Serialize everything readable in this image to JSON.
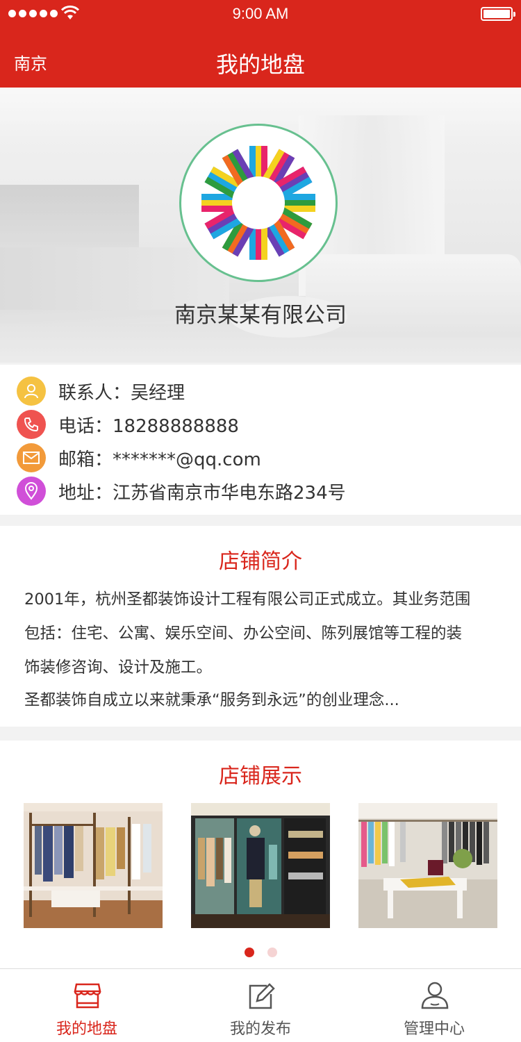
{
  "status_bar": {
    "time": "9:00 AM"
  },
  "nav": {
    "city": "南京",
    "title": "我的地盘"
  },
  "hero": {
    "company_name": "南京某某有限公司",
    "logo": "colorful-sun-logo"
  },
  "contact": [
    {
      "icon": "person-icon",
      "color": "#f5c242",
      "text": "联系人：吴经理"
    },
    {
      "icon": "phone-icon",
      "color": "#ef5350",
      "text": "电话：18288888888"
    },
    {
      "icon": "mail-icon",
      "color": "#f29a3a",
      "text": "邮箱：*******@qq.com"
    },
    {
      "icon": "location-icon",
      "color": "#d04fd8",
      "text": "地址：江苏省南京市华电东路234号"
    }
  ],
  "intro": {
    "title": "店铺简介",
    "lines": [
      "2001年，杭州圣都装饰设计工程有限公司正式成立。其业务范围",
      "包括：住宅、公寓、娱乐空间、办公空间、陈列展馆等工程的装",
      "饰装修咨询、设计及施工。",
      "圣都装饰自成立以来就秉承“服务到永远”的创业理念..."
    ]
  },
  "showcase": {
    "title": "店铺展示",
    "photos": [
      "clothing-rack-photo",
      "boutique-interior-photo",
      "store-display-photo"
    ],
    "page_count": 2,
    "active_page": 1
  },
  "tabbar": [
    {
      "label": "我的地盘",
      "icon": "store-icon",
      "active": true
    },
    {
      "label": "我的发布",
      "icon": "edit-icon",
      "active": false
    },
    {
      "label": "管理中心",
      "icon": "user-icon",
      "active": false
    }
  ],
  "colors": {
    "brand": "#d9261c",
    "logo_ring": "#67c08f"
  }
}
